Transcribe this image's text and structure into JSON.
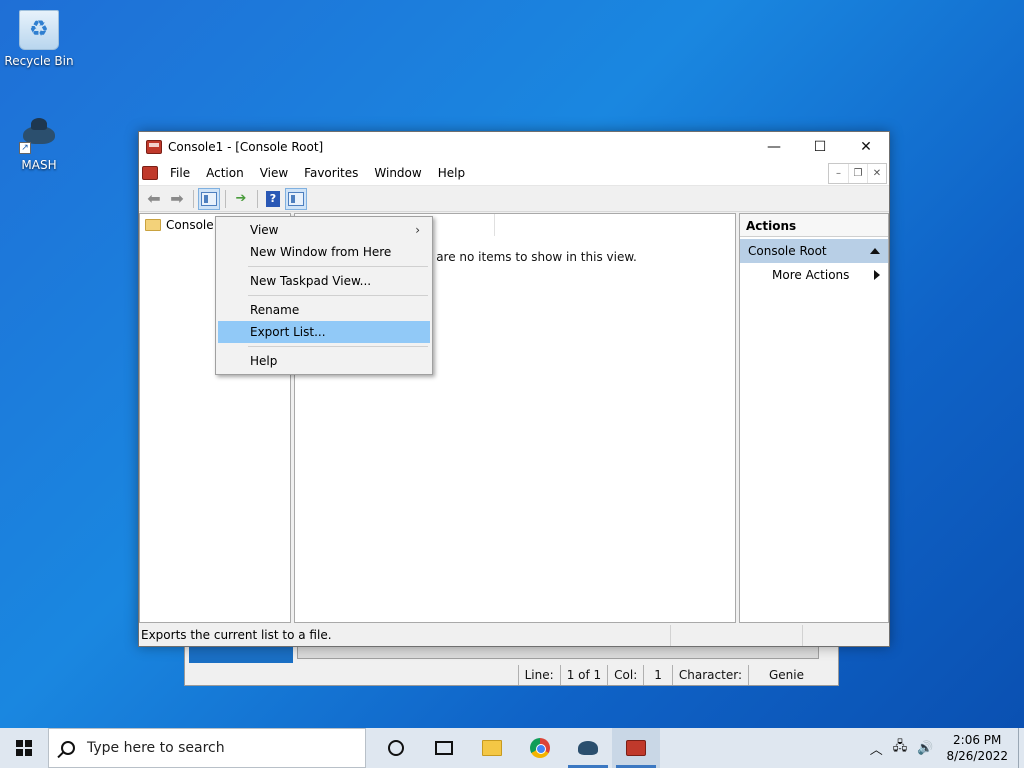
{
  "desktop": {
    "icons": [
      {
        "label": "Recycle Bin"
      },
      {
        "label": "MASH"
      }
    ]
  },
  "background_window": {
    "status": {
      "line_label": "Line:",
      "line_value": "1 of 1",
      "col_label": "Col:",
      "col_value": "1",
      "character_label": "Character:",
      "font_value": "Genie"
    }
  },
  "window": {
    "title": "Console1 - [Console Root]",
    "controls": {
      "minimize": "—",
      "maximize": "☐",
      "close": "✕"
    },
    "menu": [
      "File",
      "Action",
      "View",
      "Favorites",
      "Window",
      "Help"
    ],
    "tree": {
      "root_label": "Console R"
    },
    "list": {
      "empty_message": "e are no items to show in this view."
    },
    "actions": {
      "title": "Actions",
      "section": "Console Root",
      "more_actions": "More Actions"
    },
    "status_text": "Exports the current list to a file."
  },
  "context_menu": {
    "items": [
      {
        "label": "View",
        "submenu": true
      },
      {
        "label": "New Window from Here"
      },
      {
        "label": "New Taskpad View..."
      },
      {
        "label": "Rename"
      },
      {
        "label": "Export List...",
        "highlighted": true
      },
      {
        "label": "Help"
      }
    ],
    "highlight_color": "#91c9f7"
  },
  "taskbar": {
    "search_placeholder": "Type here to search",
    "clock": {
      "time": "2:06 PM",
      "date": "8/26/2022"
    }
  }
}
